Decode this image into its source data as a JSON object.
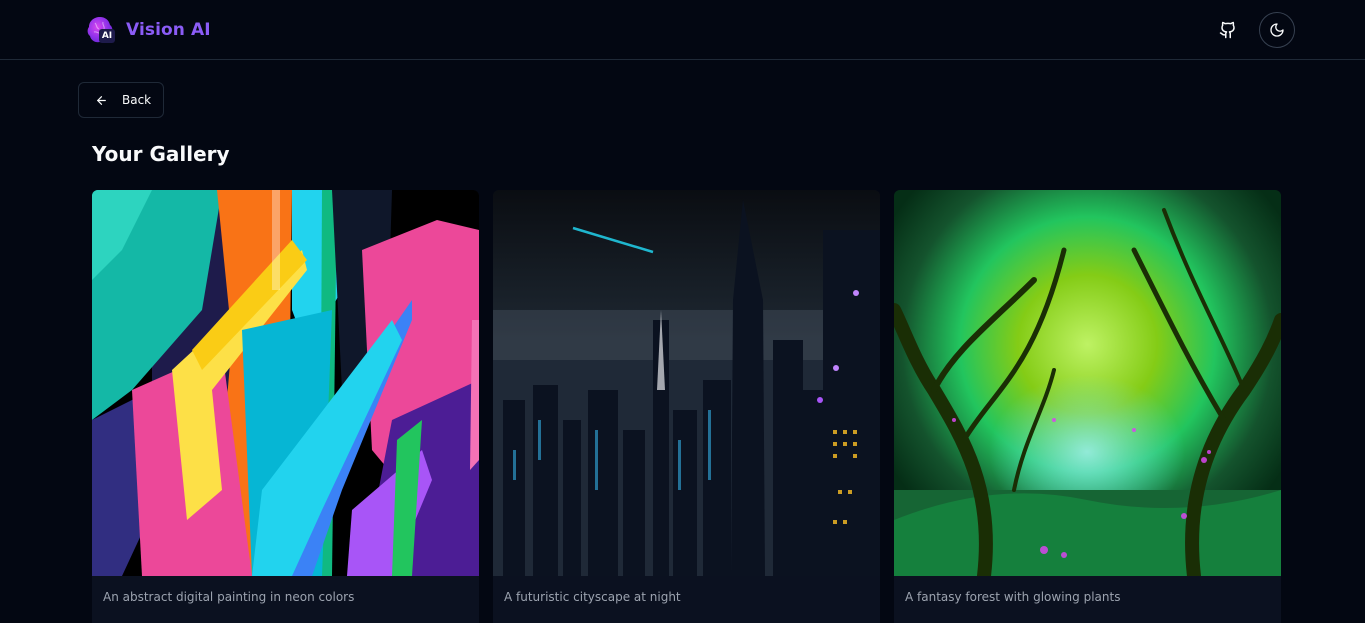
{
  "header": {
    "brand_name": "Vision AI",
    "logo_text": "AI",
    "github_icon": "github-icon",
    "theme_icon": "moon-icon"
  },
  "nav": {
    "back_label": "Back",
    "back_icon": "arrow-left-icon"
  },
  "gallery": {
    "title": "Your Gallery",
    "items": [
      {
        "caption": "An abstract digital painting in neon colors"
      },
      {
        "caption": "A futuristic cityscape at night"
      },
      {
        "caption": "A fantasy forest with glowing plants"
      }
    ]
  },
  "colors": {
    "background": "#030712",
    "brand": "#8b5cf6",
    "border": "#1f2937",
    "caption": "#9ca3af"
  }
}
